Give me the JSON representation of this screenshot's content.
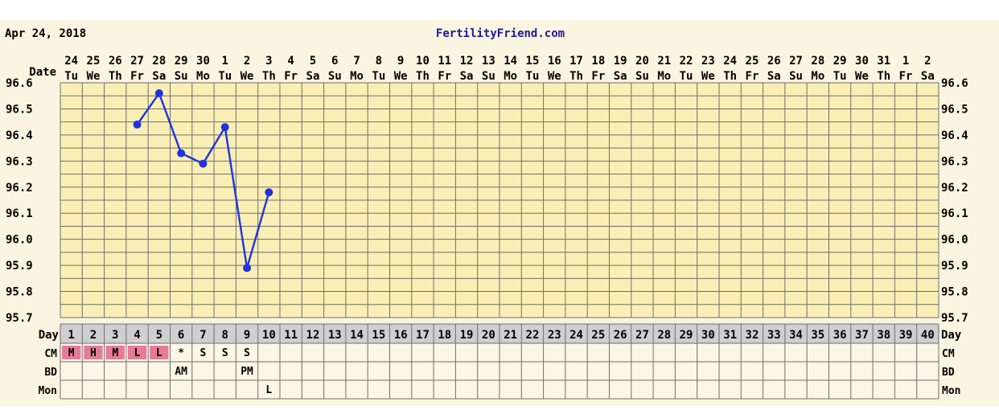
{
  "header": {
    "date": "Apr 24, 2018",
    "site": "FertilityFriend.com"
  },
  "colors": {
    "page_bg": "#fbf4e0",
    "plot_bg": "#f9efb5",
    "grid": "#6e6e6e",
    "line": "#2233dd",
    "text": "#000000",
    "site_text": "#1a1aa0",
    "day_row_bg": "#cfcfcf",
    "menstrual_bg": "#e57b98",
    "row_bg": "#fcf6e6"
  },
  "labels": {
    "date": "Date",
    "day": "Day",
    "cm": "CM",
    "bd": "BD",
    "mon": "Mon"
  },
  "chart_data": {
    "type": "line",
    "title": "",
    "xlabel": "Date",
    "ylabel": "",
    "dates": [
      "24",
      "25",
      "26",
      "27",
      "28",
      "29",
      "30",
      "1",
      "2",
      "3",
      "4",
      "5",
      "6",
      "7",
      "8",
      "9",
      "10",
      "11",
      "12",
      "13",
      "14",
      "15",
      "16",
      "17",
      "18",
      "19",
      "20",
      "21",
      "22",
      "23",
      "24",
      "25",
      "26",
      "27",
      "28",
      "29",
      "30",
      "31",
      "1",
      "2"
    ],
    "weekdays": [
      "Tu",
      "We",
      "Th",
      "Fr",
      "Sa",
      "Su",
      "Mo",
      "Tu",
      "We",
      "Th",
      "Fr",
      "Sa",
      "Su",
      "Mo",
      "Tu",
      "We",
      "Th",
      "Fr",
      "Sa",
      "Su",
      "Mo",
      "Tu",
      "We",
      "Th",
      "Fr",
      "Sa",
      "Su",
      "Mo",
      "Tu",
      "We",
      "Th",
      "Fr",
      "Sa",
      "Su",
      "Mo",
      "Tu",
      "We",
      "Th",
      "Fr",
      "Sa"
    ],
    "cycle_days": [
      "1",
      "2",
      "3",
      "4",
      "5",
      "6",
      "7",
      "8",
      "9",
      "10",
      "11",
      "12",
      "13",
      "14",
      "15",
      "16",
      "17",
      "18",
      "19",
      "20",
      "21",
      "22",
      "23",
      "24",
      "25",
      "26",
      "27",
      "28",
      "29",
      "30",
      "31",
      "32",
      "33",
      "34",
      "35",
      "36",
      "37",
      "38",
      "39",
      "40"
    ],
    "y_ticks": [
      "96.6",
      "96.5",
      "96.4",
      "96.3",
      "96.2",
      "96.1",
      "96.0",
      "95.9",
      "95.8",
      "95.7"
    ],
    "ylim": [
      95.7,
      96.6
    ],
    "grid": true,
    "series": [
      {
        "points": [
          {
            "day": 4,
            "temp": 96.44
          },
          {
            "day": 5,
            "temp": 96.56
          },
          {
            "day": 6,
            "temp": 96.33
          },
          {
            "day": 7,
            "temp": 96.29
          },
          {
            "day": 8,
            "temp": 96.43
          },
          {
            "day": 9,
            "temp": 95.89
          },
          {
            "day": 10,
            "temp": 96.18
          }
        ]
      }
    ],
    "rows": {
      "cm": [
        {
          "day": 1,
          "text": "M",
          "menstrual": true
        },
        {
          "day": 2,
          "text": "H",
          "menstrual": true
        },
        {
          "day": 3,
          "text": "M",
          "menstrual": true
        },
        {
          "day": 4,
          "text": "L",
          "menstrual": true
        },
        {
          "day": 5,
          "text": "L",
          "menstrual": true
        },
        {
          "day": 6,
          "text": "*"
        },
        {
          "day": 7,
          "text": "S"
        },
        {
          "day": 8,
          "text": "S"
        },
        {
          "day": 9,
          "text": "S"
        }
      ],
      "bd": [
        {
          "day": 6,
          "text": "AM"
        },
        {
          "day": 9,
          "text": "PM"
        }
      ],
      "mon": [
        {
          "day": 10,
          "text": "L"
        }
      ]
    }
  }
}
